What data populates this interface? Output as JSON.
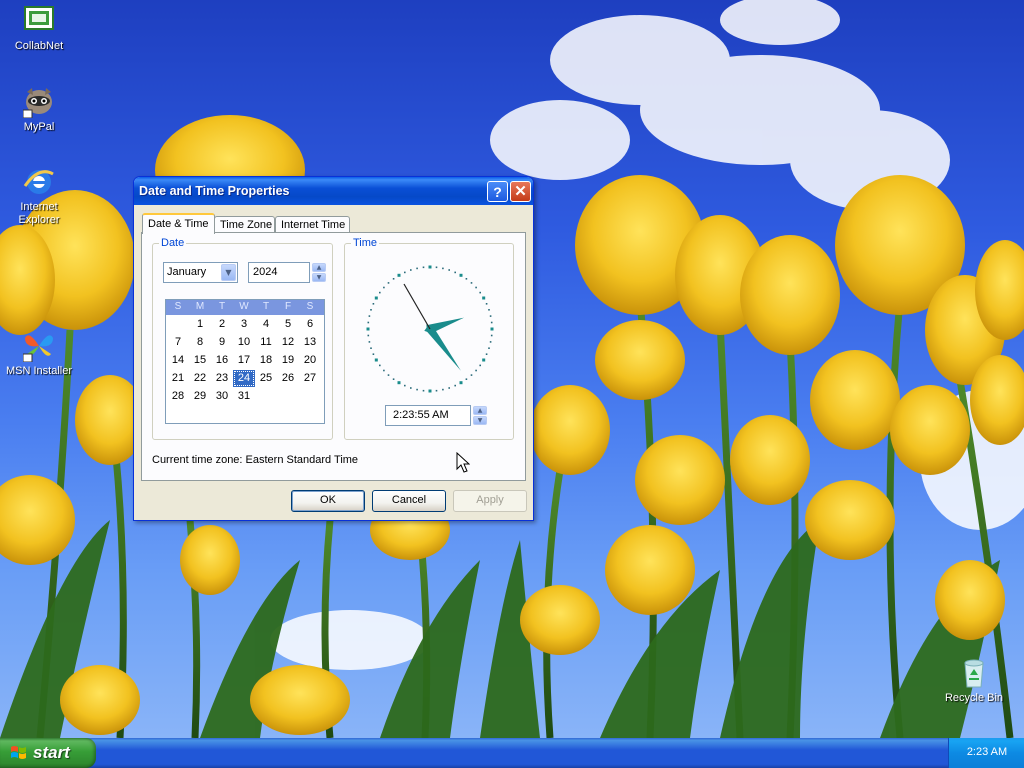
{
  "desktop": {
    "icons": [
      {
        "label": "CollabNet",
        "icon": "collabnet-icon"
      },
      {
        "label": "MyPal",
        "icon": "raccoon-icon"
      },
      {
        "label": "Internet Explorer",
        "icon": "ie-icon"
      },
      {
        "label": "MSN Installer",
        "icon": "msn-butterfly-icon"
      },
      {
        "label": "Recycle Bin",
        "icon": "recycle-bin-icon"
      }
    ]
  },
  "dialog": {
    "title": "Date and Time Properties",
    "help_glyph": "?",
    "close_glyph": "✕",
    "tabs": [
      {
        "label": "Date & Time",
        "active": true
      },
      {
        "label": "Time Zone",
        "active": false
      },
      {
        "label": "Internet Time",
        "active": false
      }
    ],
    "date_group": {
      "label": "Date",
      "month": "January",
      "year": "2024",
      "weekday_headers": [
        "S",
        "M",
        "T",
        "W",
        "T",
        "F",
        "S"
      ],
      "weeks": [
        [
          "",
          "1",
          "2",
          "3",
          "4",
          "5",
          "6"
        ],
        [
          "7",
          "8",
          "9",
          "10",
          "11",
          "12",
          "13"
        ],
        [
          "14",
          "15",
          "16",
          "17",
          "18",
          "19",
          "20"
        ],
        [
          "21",
          "22",
          "23",
          "24",
          "25",
          "26",
          "27"
        ],
        [
          "28",
          "29",
          "30",
          "31",
          "",
          "",
          ""
        ]
      ],
      "selected_day": "24"
    },
    "time_group": {
      "label": "Time",
      "time_value": "2:23:55 AM",
      "hour": 2,
      "minute": 23,
      "second": 55
    },
    "current_time_zone_text": "Current time zone:  Eastern Standard Time",
    "buttons": {
      "ok": "OK",
      "cancel": "Cancel",
      "apply": "Apply"
    }
  },
  "taskbar": {
    "start_label": "start",
    "clock": "2:23 AM"
  },
  "colors": {
    "titlebar": "#0a4fd6",
    "accent_tab": "#ffc83c",
    "calendar_header": "#7a96df",
    "selected_day": "#316ac5",
    "clock_hands": "#1a8c8c",
    "start_button": "#379e37",
    "taskbar": "#2157d7"
  }
}
